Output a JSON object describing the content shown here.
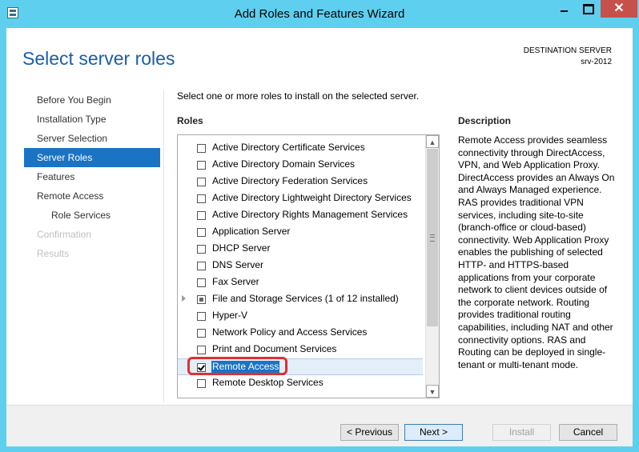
{
  "window": {
    "title": "Add Roles and Features Wizard",
    "close_glyph": "✕"
  },
  "header": {
    "page_title": "Select server roles",
    "destination_label": "DESTINATION SERVER",
    "destination_server": "srv-2012"
  },
  "nav": {
    "items": [
      {
        "label": "Before You Begin",
        "state": "normal"
      },
      {
        "label": "Installation Type",
        "state": "normal"
      },
      {
        "label": "Server Selection",
        "state": "normal"
      },
      {
        "label": "Server Roles",
        "state": "active"
      },
      {
        "label": "Features",
        "state": "normal"
      },
      {
        "label": "Remote Access",
        "state": "normal"
      },
      {
        "label": "Role Services",
        "state": "sub"
      },
      {
        "label": "Confirmation",
        "state": "disabled"
      },
      {
        "label": "Results",
        "state": "disabled"
      }
    ]
  },
  "main": {
    "instruction": "Select one or more roles to install on the selected server.",
    "roles_label": "Roles",
    "roles": [
      {
        "label": "Active Directory Certificate Services",
        "checked": false
      },
      {
        "label": "Active Directory Domain Services",
        "checked": false
      },
      {
        "label": "Active Directory Federation Services",
        "checked": false
      },
      {
        "label": "Active Directory Lightweight Directory Services",
        "checked": false
      },
      {
        "label": "Active Directory Rights Management Services",
        "checked": false
      },
      {
        "label": "Application Server",
        "checked": false
      },
      {
        "label": "DHCP Server",
        "checked": false
      },
      {
        "label": "DNS Server",
        "checked": false
      },
      {
        "label": "Fax Server",
        "checked": false
      },
      {
        "label": "File and Storage Services (1 of 12 installed)",
        "checked": "partial",
        "expandable": true
      },
      {
        "label": "Hyper-V",
        "checked": false
      },
      {
        "label": "Network Policy and Access Services",
        "checked": false
      },
      {
        "label": "Print and Document Services",
        "checked": false
      },
      {
        "label": "Remote Access",
        "checked": true,
        "selected": true
      },
      {
        "label": "Remote Desktop Services",
        "checked": false
      }
    ],
    "scroll_up_glyph": "▲",
    "scroll_down_glyph": "▼"
  },
  "description": {
    "label": "Description",
    "text": "Remote Access provides seamless connectivity through DirectAccess, VPN, and Web Application Proxy. DirectAccess provides an Always On and Always Managed experience. RAS provides traditional VPN services, including site-to-site (branch-office or cloud-based) connectivity. Web Application Proxy enables the publishing of selected HTTP- and HTTPS-based applications from your corporate network to client devices outside of the corporate network. Routing provides traditional routing capabilities, including NAT and other connectivity options. RAS and Routing can be deployed in single-tenant or multi-tenant mode."
  },
  "footer": {
    "previous": "< Previous",
    "next": "Next >",
    "install": "Install",
    "cancel": "Cancel"
  }
}
